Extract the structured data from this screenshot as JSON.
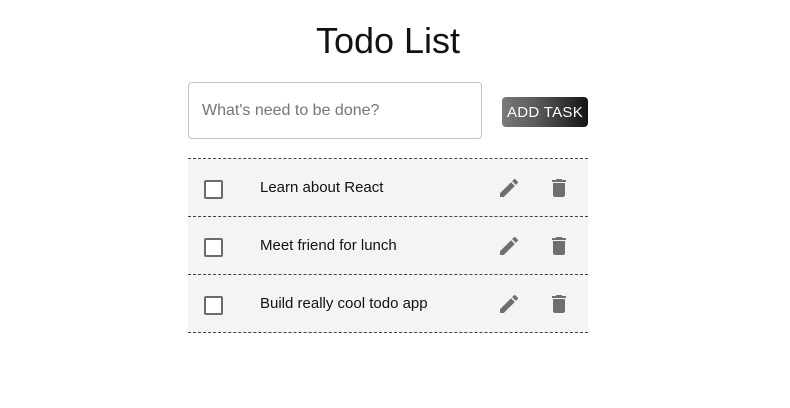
{
  "header": {
    "title": "Todo List"
  },
  "new_task": {
    "placeholder": "What's need to be done?",
    "value": "",
    "add_button_label": "ADD TASK"
  },
  "todos": [
    {
      "text": "Learn about React",
      "completed": false,
      "edit_icon": "pencil-icon",
      "delete_icon": "trash-icon"
    },
    {
      "text": "Meet friend for lunch",
      "completed": false,
      "edit_icon": "pencil-icon",
      "delete_icon": "trash-icon"
    },
    {
      "text": "Build really cool todo app",
      "completed": false,
      "edit_icon": "pencil-icon",
      "delete_icon": "trash-icon"
    }
  ],
  "colors": {
    "icon": "#6f6f6f",
    "row_background": "#f4f4f4",
    "button_gradient_start": "#7a7a7a",
    "button_gradient_end": "#141414"
  }
}
